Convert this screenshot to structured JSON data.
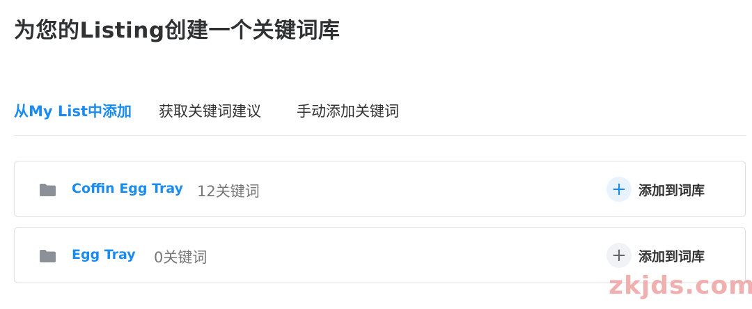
{
  "page": {
    "title": "为您的Listing创建一个关键词库"
  },
  "tabs": [
    {
      "label": "从My List中添加",
      "active": true
    },
    {
      "label": "获取关键词建议",
      "active": false
    },
    {
      "label": "手动添加关键词",
      "active": false
    }
  ],
  "lists": [
    {
      "name": "Coffin Egg Tray",
      "count": "12关键词",
      "action": "添加到词库",
      "icon": "folder-icon"
    },
    {
      "name": "Egg Tray",
      "count": "0关键词",
      "action": "添加到词库",
      "icon": "folder-icon"
    }
  ],
  "add_icon": "+",
  "watermark": "zkjds.com",
  "colors": {
    "accent": "#1a8bf0",
    "border": "#dcdfe6",
    "folder": "#8c9097"
  }
}
